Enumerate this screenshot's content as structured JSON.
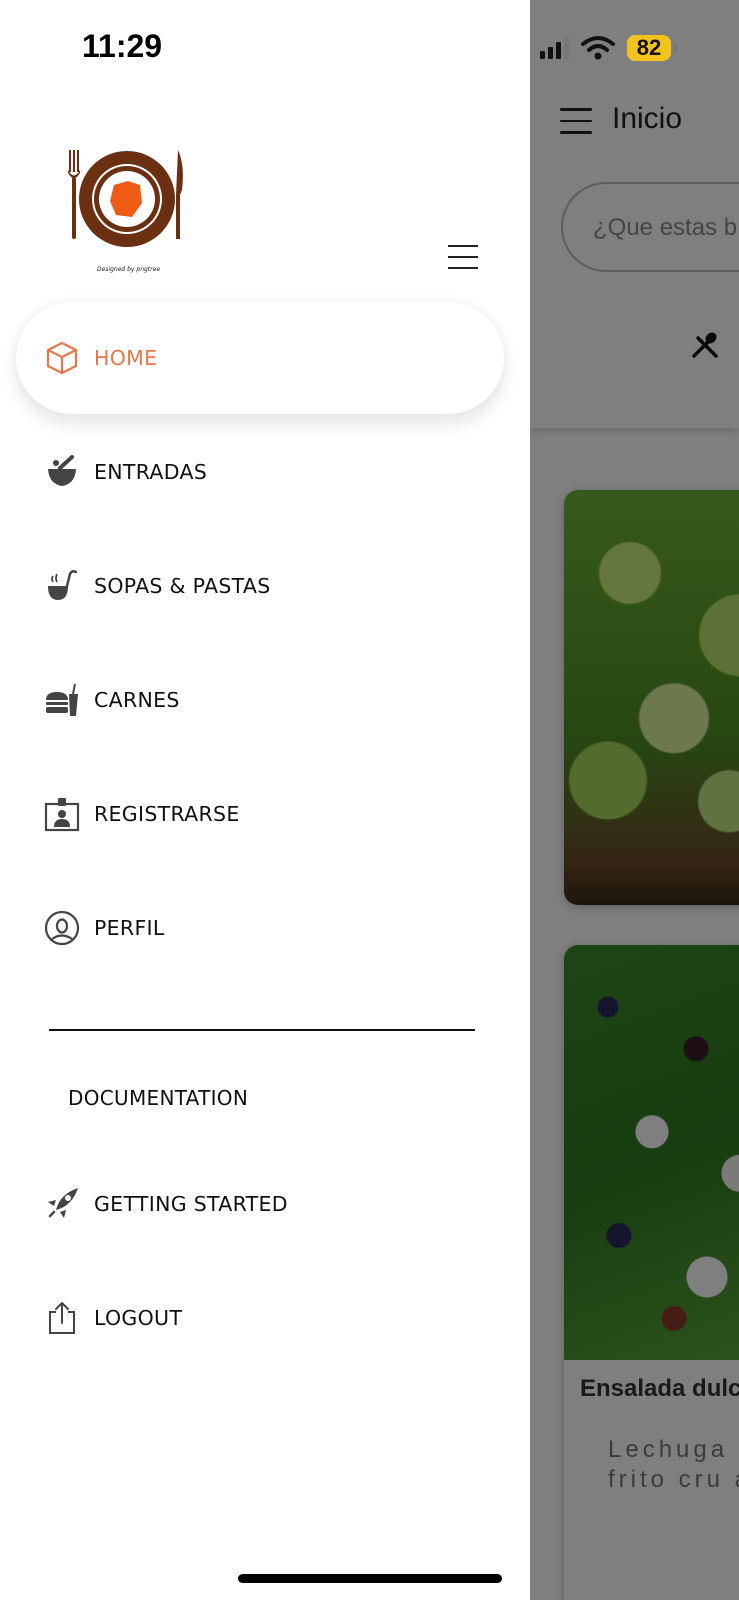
{
  "status_bar": {
    "time": "11:29",
    "battery": "82"
  },
  "background_screen": {
    "title": "Inicio",
    "search_placeholder": "¿Que estas b",
    "card_title": "Ensalada dulc",
    "card_description": "Lechuga rizada, blueberry, frito cru ajonjolí, croma"
  },
  "drawer": {
    "logo_caption": "Designed by pngtree",
    "items": [
      {
        "label": "HOME",
        "icon": "cube-icon",
        "active": true
      },
      {
        "label": "ENTRADAS",
        "icon": "mortar-pestle-icon",
        "active": false
      },
      {
        "label": "SOPAS & PASTAS",
        "icon": "soup-ladle-icon",
        "active": false
      },
      {
        "label": "CARNES",
        "icon": "fast-food-icon",
        "active": false
      },
      {
        "label": "REGISTRARSE",
        "icon": "id-badge-icon",
        "active": false
      },
      {
        "label": "PERFIL",
        "icon": "user-circle-icon",
        "active": false
      }
    ],
    "section_title": "DOCUMENTATION",
    "doc_items": [
      {
        "label": "GETTING STARTED",
        "icon": "rocket-icon"
      },
      {
        "label": "LOGOUT",
        "icon": "share-upload-icon"
      }
    ]
  },
  "colors": {
    "accent": "#e8774a",
    "battery": "#f3c21b",
    "logo_brown": "#6b2f12",
    "logo_orange": "#ef5a14"
  }
}
